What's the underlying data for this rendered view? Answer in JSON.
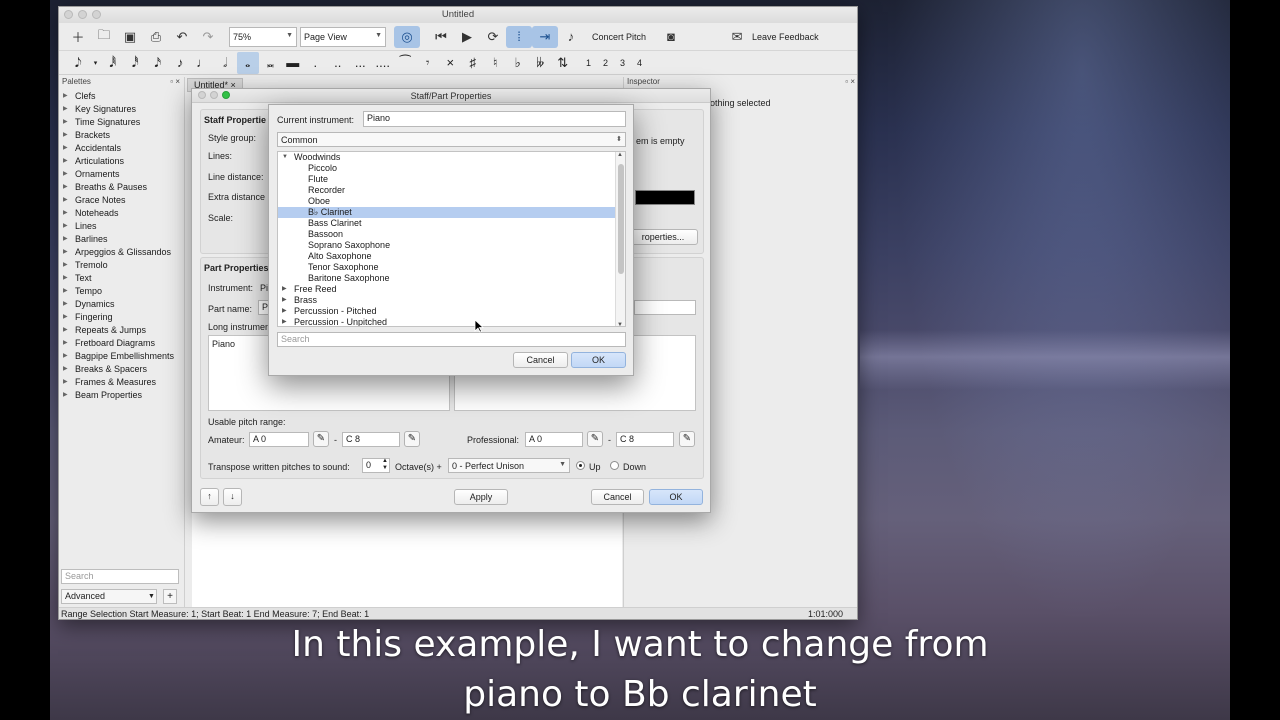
{
  "window": {
    "title": "Untitled"
  },
  "toolbar": {
    "zoom_value": "75%",
    "view_mode": "Page View",
    "concert_pitch_label": "Concert Pitch",
    "feedback_label": "Leave Feedback"
  },
  "notes_toolbar": {
    "voices": [
      "1",
      "2",
      "3",
      "4"
    ]
  },
  "palettes": {
    "header": "Palettes",
    "items": [
      "Clefs",
      "Key Signatures",
      "Time Signatures",
      "Brackets",
      "Accidentals",
      "Articulations",
      "Ornaments",
      "Breaths & Pauses",
      "Grace Notes",
      "Noteheads",
      "Lines",
      "Barlines",
      "Arpeggios & Glissandos",
      "Tremolo",
      "Text",
      "Tempo",
      "Dynamics",
      "Fingering",
      "Repeats & Jumps",
      "Fretboard Diagrams",
      "Bagpipe Embellishments",
      "Breaks & Spacers",
      "Frames & Measures",
      "Beam Properties"
    ],
    "search_placeholder": "Search",
    "workspace": "Advanced",
    "add_label": "+"
  },
  "doc_tab": {
    "label": "Untitled*"
  },
  "inspector": {
    "header": "Inspector",
    "empty_text": "othing selected"
  },
  "statusbar": {
    "selection": "Range Selection Start Measure: 1; Start Beat: 1 End Measure: 7; End Beat: 1",
    "time": "1:01:000"
  },
  "staff_dialog": {
    "title": "Staff/Part Properties",
    "staff_section": "Staff Propertie",
    "style_group_label": "Style group:",
    "lines_label": "Lines:",
    "line_distance_label": "Line distance:",
    "extra_distance_label": "Extra distance",
    "scale_label": "Scale:",
    "empty_note": "em is empty",
    "properties_button": "roperties...",
    "part_section": "Part Properties",
    "instrument_label": "Instrument:",
    "instrument_value": "Pia",
    "part_name_label": "Part name:",
    "part_name_value": "Pia",
    "long_name_label": "Long instrumen",
    "long_name_value": "Piano",
    "pitch_range_label": "Usable pitch range:",
    "amateur_label": "Amateur:",
    "amateur_low": "A 0",
    "amateur_high": "C 8",
    "professional_label": "Professional:",
    "pro_low": "A 0",
    "pro_high": "C 8",
    "dash": "-",
    "transpose_label": "Transpose written pitches to sound:",
    "octaves_value": "0",
    "octaves_label": "Octave(s) +",
    "interval_value": "0 - Perfect Unison",
    "up_label": "Up",
    "down_label": "Down",
    "move_up": "↑",
    "move_down": "↓",
    "apply_label": "Apply",
    "cancel_label": "Cancel",
    "ok_label": "OK"
  },
  "chooser": {
    "current_label": "Current instrument:",
    "current_value": "Piano",
    "group_value": "Common",
    "tree": [
      {
        "label": "Woodwinds",
        "level": 0,
        "expanded": true
      },
      {
        "label": "Piccolo",
        "level": 1
      },
      {
        "label": "Flute",
        "level": 1
      },
      {
        "label": "Recorder",
        "level": 1
      },
      {
        "label": "Oboe",
        "level": 1
      },
      {
        "label": "B♭ Clarinet",
        "level": 1,
        "selected": true
      },
      {
        "label": "Bass Clarinet",
        "level": 1
      },
      {
        "label": "Bassoon",
        "level": 1
      },
      {
        "label": "Soprano Saxophone",
        "level": 1
      },
      {
        "label": "Alto Saxophone",
        "level": 1
      },
      {
        "label": "Tenor Saxophone",
        "level": 1
      },
      {
        "label": "Baritone Saxophone",
        "level": 1
      },
      {
        "label": "Free Reed",
        "level": 0,
        "expanded": false
      },
      {
        "label": "Brass",
        "level": 0,
        "expanded": false
      },
      {
        "label": "Percussion - Pitched",
        "level": 0,
        "expanded": false
      },
      {
        "label": "Percussion - Unpitched",
        "level": 0,
        "expanded": false
      }
    ],
    "search_placeholder": "Search",
    "cancel_label": "Cancel",
    "ok_label": "OK"
  },
  "caption": {
    "line1": "In this example, I want to change from",
    "line2": "piano to Bb clarinet"
  },
  "colors": {
    "selection": "#b5cdf0",
    "accent": "#4d8fe4",
    "toggle_active": "#a8c4e6"
  }
}
